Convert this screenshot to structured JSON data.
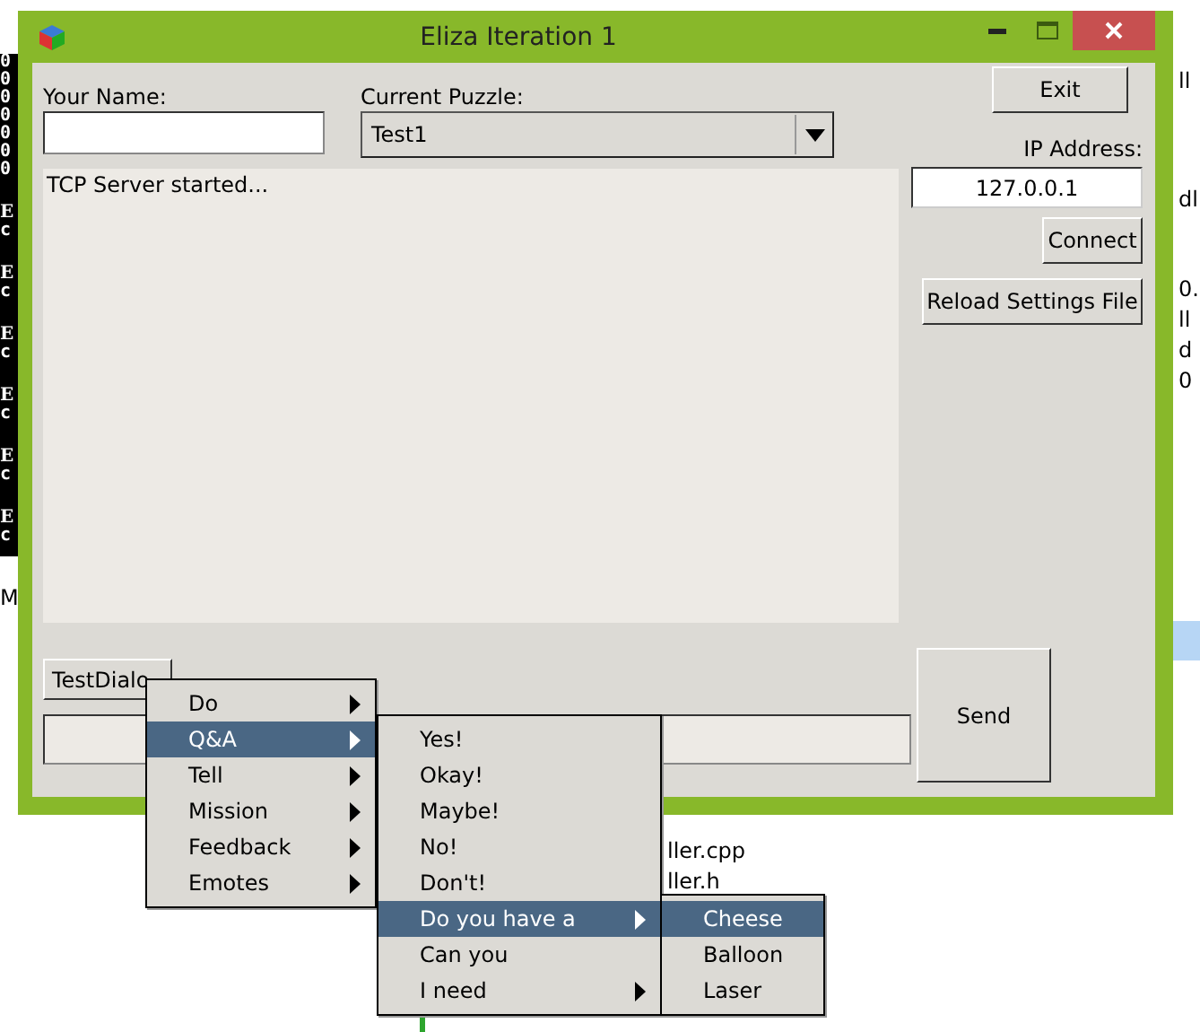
{
  "console": {
    "lines": [
      "0",
      "0",
      "0",
      "0",
      "0",
      "0",
      "0",
      "E",
      "c",
      "E",
      "c",
      "E",
      "c",
      "E",
      "c",
      "E",
      "c",
      "E",
      "c"
    ]
  },
  "background_fragments": [
    "ll",
    "dl",
    "0.",
    "ll",
    "d",
    "0",
    "M",
    "ller.cpp",
    "ller.h"
  ],
  "window": {
    "title": "Eliza Iteration 1"
  },
  "form": {
    "name_label": "Your Name:",
    "puzzle_label": "Current Puzzle:",
    "puzzle_value": "Test1",
    "log": "TCP Server started...",
    "exit_button": "Exit",
    "ip_label": "IP Address:",
    "ip_value": "127.0.0.1",
    "connect_button": "Connect",
    "reload_button": "Reload Settings File",
    "dialog_button": "TestDialo",
    "send_button": "Send"
  },
  "menus": [
    {
      "items": [
        {
          "label": "Do",
          "submenu": true,
          "selected": false
        },
        {
          "label": "Q&A",
          "submenu": true,
          "selected": true
        },
        {
          "label": "Tell",
          "submenu": true,
          "selected": false
        },
        {
          "label": "Mission",
          "submenu": true,
          "selected": false
        },
        {
          "label": "Feedback",
          "submenu": true,
          "selected": false
        },
        {
          "label": "Emotes",
          "submenu": true,
          "selected": false
        }
      ]
    },
    {
      "items": [
        {
          "label": "Yes!",
          "submenu": false,
          "selected": false
        },
        {
          "label": "Okay!",
          "submenu": false,
          "selected": false
        },
        {
          "label": "Maybe!",
          "submenu": false,
          "selected": false
        },
        {
          "label": "No!",
          "submenu": false,
          "selected": false
        },
        {
          "label": "Don't!",
          "submenu": false,
          "selected": false
        },
        {
          "label": "Do you have a",
          "submenu": true,
          "selected": true
        },
        {
          "label": "Can you",
          "submenu": false,
          "selected": false
        },
        {
          "label": "I need",
          "submenu": true,
          "selected": false
        }
      ]
    },
    {
      "items": [
        {
          "label": "Cheese",
          "submenu": false,
          "selected": true
        },
        {
          "label": "Balloon",
          "submenu": false,
          "selected": false
        },
        {
          "label": "Laser",
          "submenu": false,
          "selected": false
        }
      ]
    }
  ]
}
